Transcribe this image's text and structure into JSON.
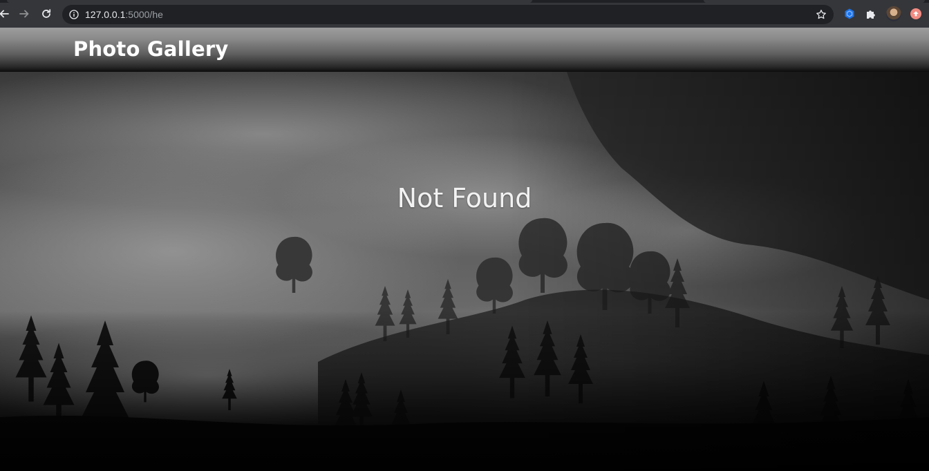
{
  "browser": {
    "url_host": "127.0.0.1",
    "url_rest": ":5000/he",
    "icons": {
      "back": "arrow-left-icon",
      "forward": "arrow-right-icon",
      "reload": "reload-icon",
      "site_info": "info-icon",
      "bookmark": "star-icon",
      "extension_1": "hexagon-extension-icon",
      "extensions": "puzzle-icon",
      "profile": "avatar",
      "extension_2": "alert-extension-icon"
    }
  },
  "site": {
    "title": "Photo Gallery"
  },
  "main": {
    "message": "Not Found",
    "background": "misty-forest-photo"
  },
  "colors": {
    "chrome_bar": "#35363a",
    "omnibox": "#202124",
    "header_top": "#9d9d9d",
    "header_bottom": "#0c0c0c",
    "text_white": "#ffffff"
  }
}
